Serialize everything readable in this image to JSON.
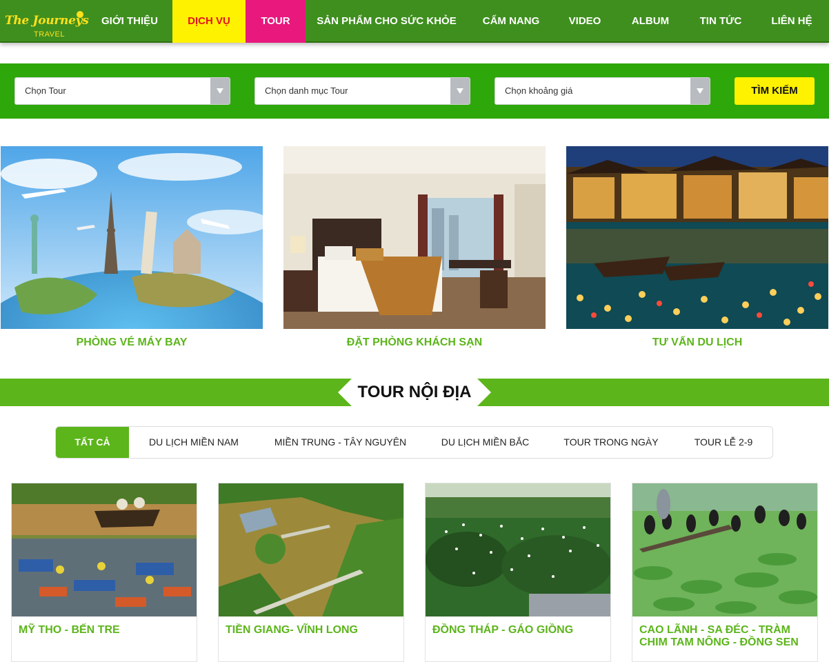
{
  "logo": {
    "script": "The Journeys",
    "sub": "TRAVEL"
  },
  "nav": {
    "items": [
      "GIỚI THIỆU",
      "DỊCH VỤ",
      "TOUR",
      "SẢN PHẨM CHO SỨC KHỎE",
      "CẨM NANG",
      "VIDEO",
      "ALBUM",
      "TIN TỨC",
      "LIÊN HỆ"
    ]
  },
  "search": {
    "select_tour": "Chọn Tour",
    "select_category": "Chọn danh mục Tour",
    "select_price": "Chọn khoảng giá",
    "button": "TÌM KIẾM"
  },
  "services": [
    {
      "label": "PHÒNG VÉ MÁY BAY",
      "image": "world-landmarks-globe"
    },
    {
      "label": "ĐẶT PHÒNG KHÁCH SẠN",
      "image": "hotel-room"
    },
    {
      "label": "TƯ VẤN DU LỊCH",
      "image": "hoi-an-night-lanterns"
    }
  ],
  "section": {
    "title": "TOUR NỘI ĐỊA"
  },
  "tabs": [
    "TẤT CẢ",
    "DU LỊCH MIỀN NAM",
    "MIỀN TRUNG - TÂY NGUYÊN",
    "DU LỊCH MIỀN BẮC",
    "TOUR TRONG NGÀY",
    "TOUR LỄ 2-9"
  ],
  "tours": [
    {
      "title": "MỸ THO - BẾN TRE",
      "image": "floating-market-boats"
    },
    {
      "title": "TIỀN GIANG- VĨNH LONG",
      "image": "flooded-river-house"
    },
    {
      "title": "ĐỒNG THÁP - GÁO GIỒNG",
      "image": "stork-forest"
    },
    {
      "title": "CAO LÃNH - SA ĐÉC - TRÀM CHIM TAM NÔNG - ĐỒNG SEN",
      "image": "birds-on-lotus-pond"
    }
  ],
  "colors": {
    "nav_bg": "#3f8f1f",
    "search_bg": "#2ea70a",
    "accent_green": "#5cb51b",
    "yellow": "#fff200",
    "pink": "#e8187d"
  }
}
